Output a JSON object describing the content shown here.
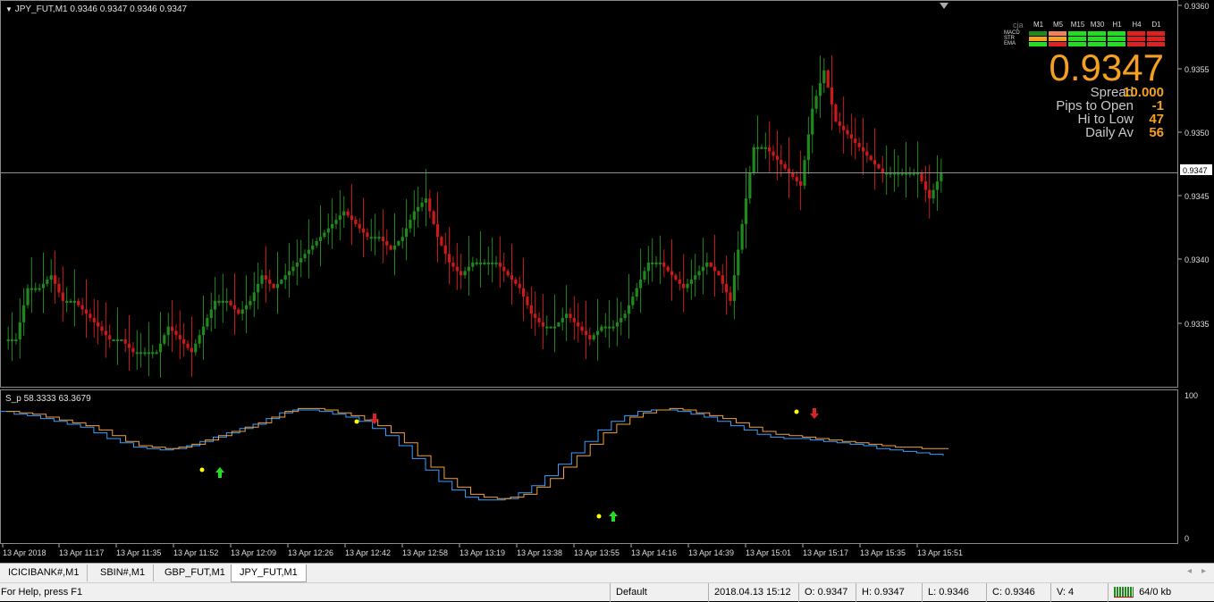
{
  "main_chart": {
    "header": "JPY_FUT,M1  0.9346 0.9347 0.9346 0.9347",
    "current_price": "0.9347",
    "price_ticks": [
      "0.9360",
      "0.9355",
      "0.9350",
      "0.9345",
      "0.9340",
      "0.9335"
    ]
  },
  "info_panel": {
    "watermark": "cja",
    "timeframes": [
      "M1",
      "M5",
      "M15",
      "M30",
      "H1",
      "H4",
      "D1"
    ],
    "indicators": [
      "MACD",
      "STR",
      "EMA"
    ],
    "big_price": "0.9347",
    "rows": [
      {
        "label": "Spread",
        "value": "10.000"
      },
      {
        "label": "Pips to Open",
        "value": "-1"
      },
      {
        "label": "Hi to Low",
        "value": "47"
      },
      {
        "label": "Daily Av",
        "value": "56"
      }
    ],
    "colors": {
      "green": "#22dd22",
      "red": "#dd2222",
      "orange": "#f5a020",
      "salmon": "#f08060",
      "dkgreen": "#1e8a1e"
    }
  },
  "sub_chart": {
    "header": "S_p 58.3333 63.3679",
    "scale_top": "100",
    "scale_bottom": "0"
  },
  "time_axis": [
    "13 Apr 2018",
    "13 Apr 11:17",
    "13 Apr 11:35",
    "13 Apr 11:52",
    "13 Apr 12:09",
    "13 Apr 12:26",
    "13 Apr 12:42",
    "13 Apr 12:58",
    "13 Apr 13:19",
    "13 Apr 13:38",
    "13 Apr 13:55",
    "13 Apr 14:16",
    "13 Apr 14:39",
    "13 Apr 15:01",
    "13 Apr 15:17",
    "13 Apr 15:35",
    "13 Apr 15:51"
  ],
  "tabs": [
    "ICICIBANK#,M1",
    "SBIN#,M1",
    "GBP_FUT,M1",
    "JPY_FUT,M1"
  ],
  "status": {
    "help": "For Help, press F1",
    "profile": "Default",
    "datetime": "2018.04.13 15:12",
    "open": "O: 0.9347",
    "high": "H: 0.9347",
    "low": "L: 0.9346",
    "close": "C: 0.9346",
    "volume": "V: 4",
    "traffic": "64/0 kb"
  },
  "chart_data": [
    {
      "type": "bar",
      "subtype": "ohlc",
      "symbol": "JPY_FUT",
      "timeframe": "M1",
      "ylim": [
        0.9331,
        0.936
      ],
      "current_price": 0.9347,
      "closes": [
        0.9334,
        0.9338,
        0.9338,
        0.9339,
        0.9337,
        0.9337,
        0.9336,
        0.9335,
        0.9334,
        0.9334,
        0.9333,
        0.9333,
        0.9333,
        0.9335,
        0.9334,
        0.9333,
        0.9335,
        0.9337,
        0.9337,
        0.9336,
        0.9337,
        0.9339,
        0.9338,
        0.9339,
        0.934,
        0.9341,
        0.9342,
        0.9343,
        0.9344,
        0.9343,
        0.9342,
        0.9342,
        0.9341,
        0.9342,
        0.9344,
        0.9345,
        0.9342,
        0.934,
        0.9339,
        0.934,
        0.934,
        0.934,
        0.9339,
        0.9338,
        0.9336,
        0.9335,
        0.9335,
        0.9336,
        0.9335,
        0.9334,
        0.9335,
        0.9335,
        0.9336,
        0.9338,
        0.934,
        0.934,
        0.9339,
        0.9338,
        0.9339,
        0.934,
        0.9339,
        0.9337,
        0.9343,
        0.9349,
        0.9349,
        0.9348,
        0.9347,
        0.9346,
        0.9352,
        0.9355,
        0.9351,
        0.935,
        0.9349,
        0.9348,
        0.9347,
        0.9347,
        0.9347,
        0.9347,
        0.9345,
        0.9347
      ],
      "volume_bar": 4
    },
    {
      "type": "line",
      "name": "S_p",
      "ylim": [
        0,
        100
      ],
      "series": [
        {
          "values": [
            89,
            87,
            86,
            84,
            82,
            80,
            78,
            74,
            70,
            67,
            64,
            63,
            62,
            63,
            65,
            68,
            71,
            74,
            77,
            80,
            84,
            88,
            90,
            90,
            89,
            87,
            85,
            82,
            77,
            72,
            65,
            56,
            48,
            40,
            34,
            29,
            27,
            27,
            28,
            32,
            37,
            44,
            52,
            60,
            68,
            76,
            82,
            86,
            89,
            90,
            90,
            89,
            87,
            85,
            82,
            79,
            76,
            73,
            71,
            70,
            70,
            69,
            68,
            67,
            66,
            65,
            63,
            62,
            61,
            60,
            59,
            58
          ]
        },
        {
          "values": [
            89,
            88,
            87,
            85,
            83,
            81,
            79,
            76,
            72,
            68,
            65,
            64,
            63,
            64,
            66,
            69,
            72,
            75,
            78,
            81,
            85,
            89,
            91,
            91,
            90,
            88,
            86,
            83,
            79,
            74,
            67,
            58,
            50,
            42,
            36,
            31,
            29,
            28,
            29,
            31,
            36,
            42,
            50,
            58,
            66,
            74,
            80,
            85,
            88,
            90,
            91,
            90,
            88,
            86,
            84,
            81,
            78,
            75,
            73,
            72,
            71,
            70,
            69,
            68,
            67,
            66,
            65,
            64,
            64,
            63,
            63,
            63
          ]
        }
      ]
    }
  ]
}
